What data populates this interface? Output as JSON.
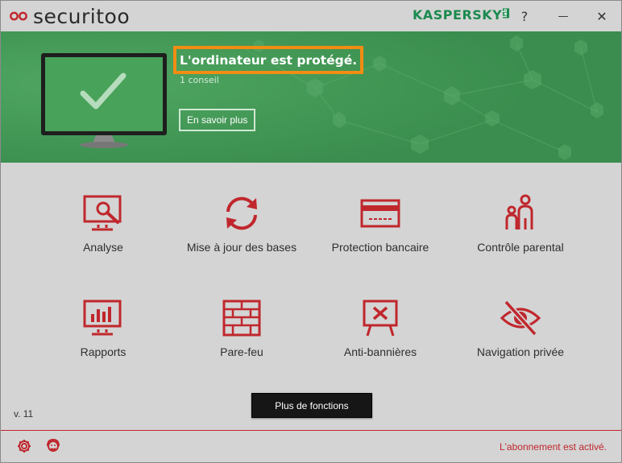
{
  "app": {
    "name": "securitoo",
    "vendor": "KASPERSKY",
    "vendor_badge": "lab"
  },
  "titlebar": {
    "help": "?",
    "minimize": "—",
    "close": "✕"
  },
  "status": {
    "title": "L'ordinateur est protégé.",
    "subtitle": "1 conseil",
    "learn_more": "En savoir plus"
  },
  "tiles": [
    {
      "label": "Analyse",
      "icon": "scan-monitor-icon"
    },
    {
      "label": "Mise à jour des bases",
      "icon": "update-arrows-icon"
    },
    {
      "label": "Protection bancaire",
      "icon": "bank-card-icon"
    },
    {
      "label": "Contrôle parental",
      "icon": "parent-child-icon"
    },
    {
      "label": "Rapports",
      "icon": "reports-chart-icon"
    },
    {
      "label": "Pare-feu",
      "icon": "firewall-bricks-icon"
    },
    {
      "label": "Anti-bannières",
      "icon": "anti-banner-icon"
    },
    {
      "label": "Navigation privée",
      "icon": "private-eye-icon"
    }
  ],
  "footer": {
    "version": "v. 11",
    "more_features": "Plus de fonctions",
    "subscription": "L'abonnement est activé."
  },
  "colors": {
    "accent_red": "#c0272d",
    "hero_green": "#3e9352",
    "highlight_orange": "#f28c12",
    "brand_green": "#1b8a4f"
  }
}
